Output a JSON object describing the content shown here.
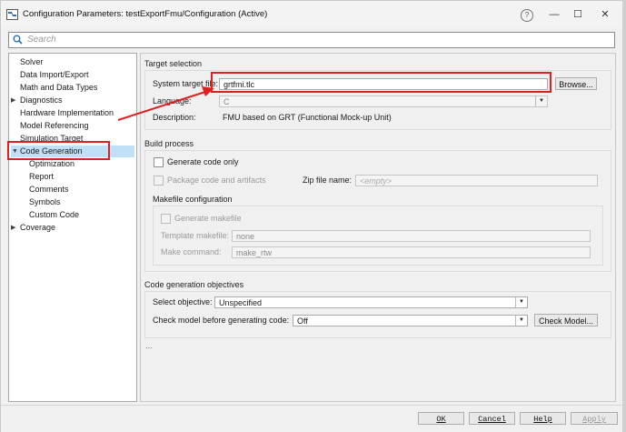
{
  "window": {
    "title": "Configuration Parameters: testExportFmu/Configuration (Active)",
    "help": "?",
    "minimize": "—",
    "maximize": "☐",
    "close": "✕"
  },
  "search": {
    "placeholder": "Search"
  },
  "tree": {
    "items": [
      {
        "label": "Solver"
      },
      {
        "label": "Data Import/Export"
      },
      {
        "label": "Math and Data Types"
      },
      {
        "label": "Diagnostics"
      },
      {
        "label": "Hardware Implementation"
      },
      {
        "label": "Model Referencing"
      },
      {
        "label": "Simulation Target"
      },
      {
        "label": "Code Generation"
      },
      {
        "label": "Optimization"
      },
      {
        "label": "Report"
      },
      {
        "label": "Comments"
      },
      {
        "label": "Symbols"
      },
      {
        "label": "Custom Code"
      },
      {
        "label": "Coverage"
      }
    ],
    "selected": "Code Generation"
  },
  "target_selection": {
    "header": "Target selection",
    "system_target_label": "System target file:",
    "system_target_value": "grtfmi.tlc",
    "browse": "Browse...",
    "language_label": "Language:",
    "language_value": "C",
    "description_label": "Description:",
    "description_value": "FMU based on GRT (Functional Mock-up Unit)"
  },
  "build_process": {
    "header": "Build process",
    "generate_code_only": "Generate code only",
    "package_code": "Package code and artifacts",
    "zip_label": "Zip file name:",
    "zip_placeholder": "<empty>",
    "makefile_header": "Makefile configuration",
    "generate_makefile": "Generate makefile",
    "template_label": "Template makefile:",
    "template_value": "none",
    "make_cmd_label": "Make command:",
    "make_cmd_value": "make_rtw"
  },
  "objectives": {
    "header": "Code generation objectives",
    "select_label": "Select objective:",
    "select_value": "Unspecified",
    "check_label": "Check model before generating code:",
    "check_value": "Off",
    "check_button": "Check Model..."
  },
  "ellipsis": "...",
  "footer": {
    "ok": "OK",
    "cancel": "Cancel",
    "help": "Help",
    "apply": "Apply"
  },
  "colors": {
    "selection": "#bfe0f7",
    "annotation": "#e02020"
  }
}
